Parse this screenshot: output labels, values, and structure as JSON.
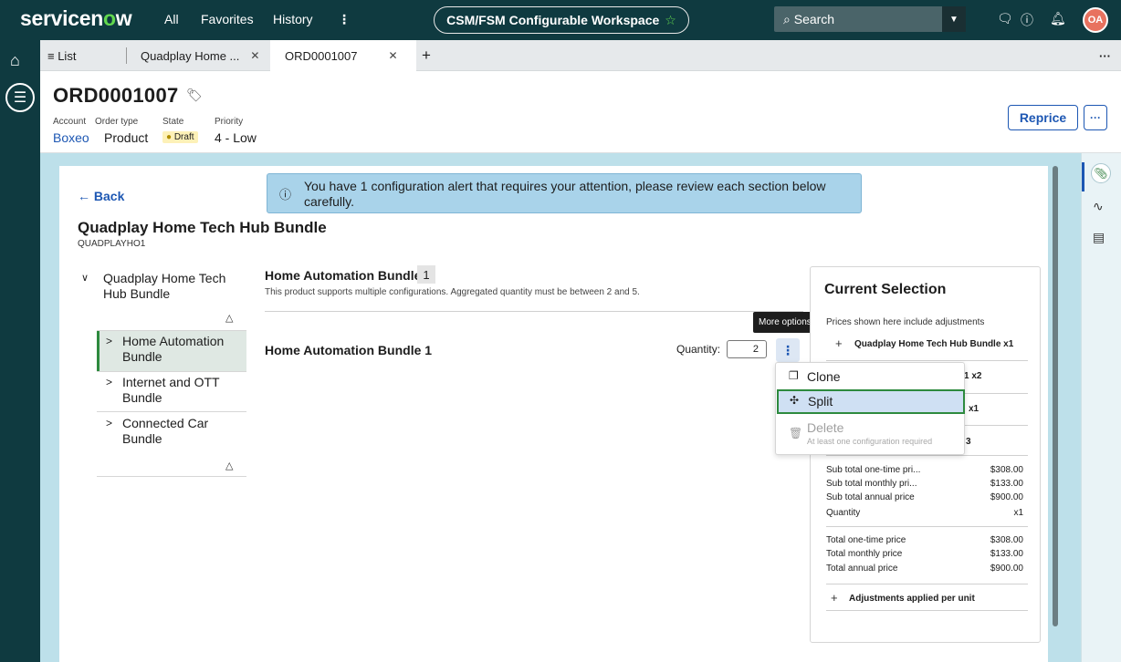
{
  "nav": {
    "logo_text": "servicen",
    "logo_o": "o",
    "logo_end": "w",
    "links": [
      "All",
      "Favorites",
      "History"
    ],
    "more": "⋮",
    "workspace": "CSM/FSM Configurable Workspace",
    "search_placeholder": "Search",
    "avatar": "OA"
  },
  "tabs": {
    "list_label": "List",
    "tab1": "Quadplay Home ...",
    "tab2": "ORD0001007",
    "add": "+",
    "overflow": "···"
  },
  "record": {
    "number": "ORD0001007",
    "fields": [
      {
        "label": "Account",
        "value": "Boxeo"
      },
      {
        "label": "Order type",
        "value": "Product"
      },
      {
        "label": "State",
        "value": "Draft"
      },
      {
        "label": "Priority",
        "value": "4 - Low"
      }
    ],
    "reprice": "Reprice",
    "more": "···"
  },
  "main": {
    "back": "Back",
    "alert": "You have 1 configuration alert that requires your attention, please review each section below carefully.",
    "product_title": "Quadplay Home Tech Hub Bundle",
    "product_code": "QUADPLAYHO1"
  },
  "tree": {
    "root": "Quadplay Home Tech Hub Bundle",
    "items": [
      "Home Automation Bundle",
      "Internet and OTT Bundle",
      "Connected Car Bundle"
    ]
  },
  "config": {
    "heading": "Home Automation Bundle",
    "count": "1",
    "subtext": "This product supports multiple configurations. Aggregated quantity must be between 2 and 5.",
    "item_title": "Home Automation Bundle 1",
    "quantity_label": "Quantity:",
    "quantity_value": "2",
    "tooltip": "More options"
  },
  "menu": {
    "clone": "Clone",
    "split": "Split",
    "delete": "Delete",
    "delete_sub": "At least one configuration required"
  },
  "selection": {
    "title": "Current Selection",
    "note": "Prices shown here include adjustments",
    "bundle": "Quadplay Home Tech Hub Bundle x1",
    "partial1": "1 x2",
    "partial2": "x1",
    "partial3": "3",
    "subtotals": [
      {
        "label": "Sub total one-time pri...",
        "value": "$308.00"
      },
      {
        "label": "Sub total monthly pri...",
        "value": "$133.00"
      },
      {
        "label": "Sub total annual price",
        "value": "$900.00"
      },
      {
        "label": "Quantity",
        "value": "x1"
      }
    ],
    "totals": [
      {
        "label": "Total one-time price",
        "value": "$308.00"
      },
      {
        "label": "Total monthly price",
        "value": "$133.00"
      },
      {
        "label": "Total annual price",
        "value": "$900.00"
      }
    ],
    "adjustments": "Adjustments applied per unit"
  }
}
